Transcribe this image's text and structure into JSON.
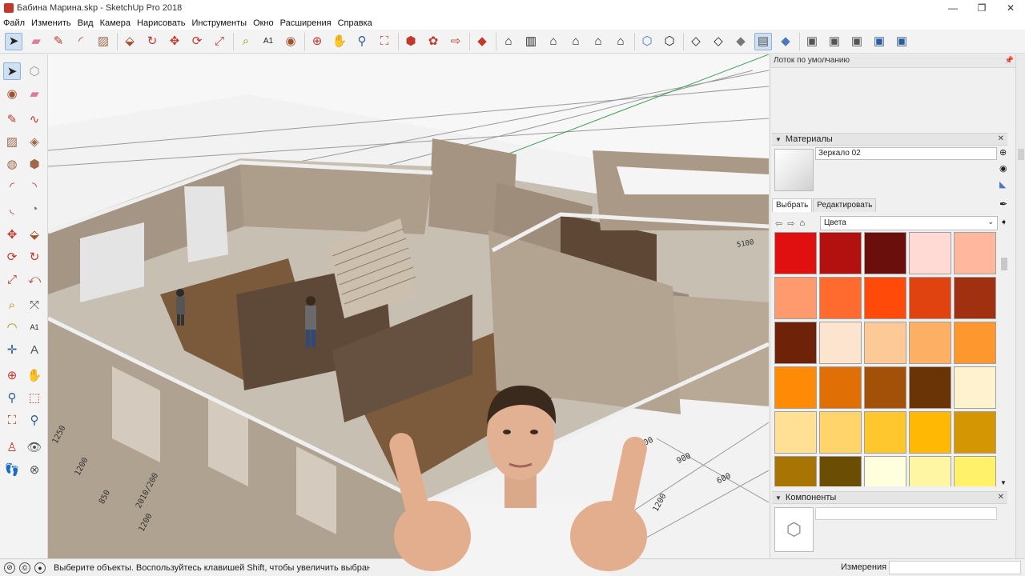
{
  "window": {
    "title": "Бабина Марина.skp - SketchUp Pro 2018",
    "controls": [
      "—",
      "❐",
      "✕"
    ]
  },
  "menu": [
    "Файл",
    "Изменить",
    "Вид",
    "Камера",
    "Нарисовать",
    "Инструменты",
    "Окно",
    "Расширения",
    "Справка"
  ],
  "toolbar": {
    "icons": [
      "select-tool",
      "eraser-tool",
      "pencil-tool",
      "arc-tool",
      "rectangle-tool",
      "push-pull-tool",
      "follow-me-tool",
      "move-tool",
      "rotate-tool",
      "scale-tool",
      "tape-measure-tool",
      "text-tool",
      "paint-bucket-tool",
      "orbit-tool",
      "pan-tool",
      "zoom-tool",
      "zoom-extents-tool",
      "warehouse-icon",
      "extension-warehouse-icon",
      "send-to-layout-icon",
      "ruby-console-icon",
      "iso-view-icon",
      "top-view-icon",
      "front-view-icon",
      "right-view-icon",
      "back-view-icon",
      "left-view-icon",
      "xray-icon",
      "back-edges-icon",
      "wireframe-icon",
      "hidden-line-icon",
      "shaded-icon",
      "shaded-textures-icon",
      "monochrome-icon",
      "union-icon",
      "subtract-icon",
      "intersect-icon",
      "trim-icon",
      "split-icon"
    ]
  },
  "tray": {
    "title": "Лоток по умолчанию",
    "materials": {
      "header": "Материалы",
      "name": "Зеркало 02",
      "tab_select": "Выбрать",
      "tab_edit": "Редактировать",
      "collection": "Цвета",
      "swatches": [
        "#e01010",
        "#b31010",
        "#6a0f0c",
        "#ffd9d3",
        "#ffb89e",
        "#ff9a6e",
        "#ff6a2e",
        "#ff4a0a",
        "#e04310",
        "#a13010",
        "#6e2208",
        "#fde4cf",
        "#fdc997",
        "#fdb063",
        "#fe982e",
        "#ff8a05",
        "#e06f06",
        "#a35008",
        "#6a3406",
        "#fff2cf",
        "#ffe094",
        "#ffd46a",
        "#ffc72e",
        "#ffb804",
        "#d59604",
        "#a87404",
        "#6b4d04",
        "#ffffdd",
        "#fff6a3",
        "#fff16a",
        "#ffe80a",
        "#f5dd05",
        "#d9c404",
        "#b3a104",
        "#7c7004"
      ]
    },
    "components": {
      "header": "Компоненты"
    }
  },
  "status": {
    "text": "Выберите объекты. Воспользуйтесь клавишей Shift, чтобы увеличить выбранную",
    "measure_label": "Измерения"
  },
  "viewport": {
    "dimensions": [
      "1200",
      "850",
      "2010/200",
      "1200",
      "400",
      "900",
      "600",
      "1200",
      "1250",
      "5100"
    ]
  }
}
